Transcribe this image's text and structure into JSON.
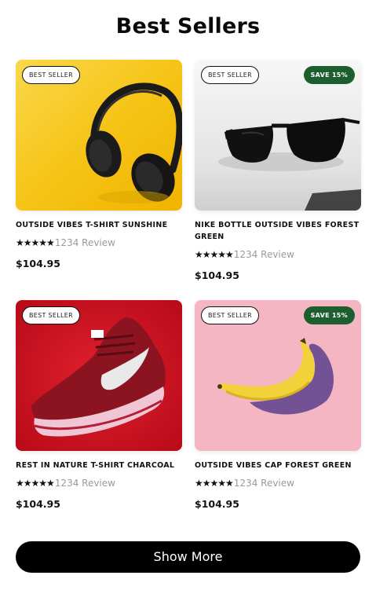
{
  "page": {
    "title": "Best Sellers"
  },
  "products": [
    {
      "badge": "BEST SELLER",
      "discount": "",
      "name": "OUTSIDE VIBES T-SHIRT SUNSHINE",
      "stars": "★★★★★",
      "reviews": "1234 Review",
      "price": "$104.95",
      "image": "headphones",
      "bg": "#f6c417"
    },
    {
      "badge": "BEST SELLER",
      "discount": "SAVE 15%",
      "name": "NIKE BOTTLE OUTSIDE VIBES FOREST GREEN",
      "stars": "★★★★★",
      "reviews": "1234 Review",
      "price": "$104.95",
      "image": "sunglasses",
      "bg": "#ececec"
    },
    {
      "badge": "BEST SELLER",
      "discount": "",
      "name": "REST IN NATURE T-SHIRT CHARCOAL",
      "stars": "★★★★★",
      "reviews": "1234 Review",
      "price": "$104.95",
      "image": "sneaker",
      "bg": "#cf1020"
    },
    {
      "badge": "BEST SELLER",
      "discount": "SAVE 15%",
      "name": "OUTSIDE VIBES CAP FOREST GREEN",
      "stars": "★★★★★",
      "reviews": "1234 Review",
      "price": "$104.95",
      "image": "banana",
      "bg": "#f4b6c2"
    }
  ],
  "actions": {
    "show_more": "Show More"
  }
}
